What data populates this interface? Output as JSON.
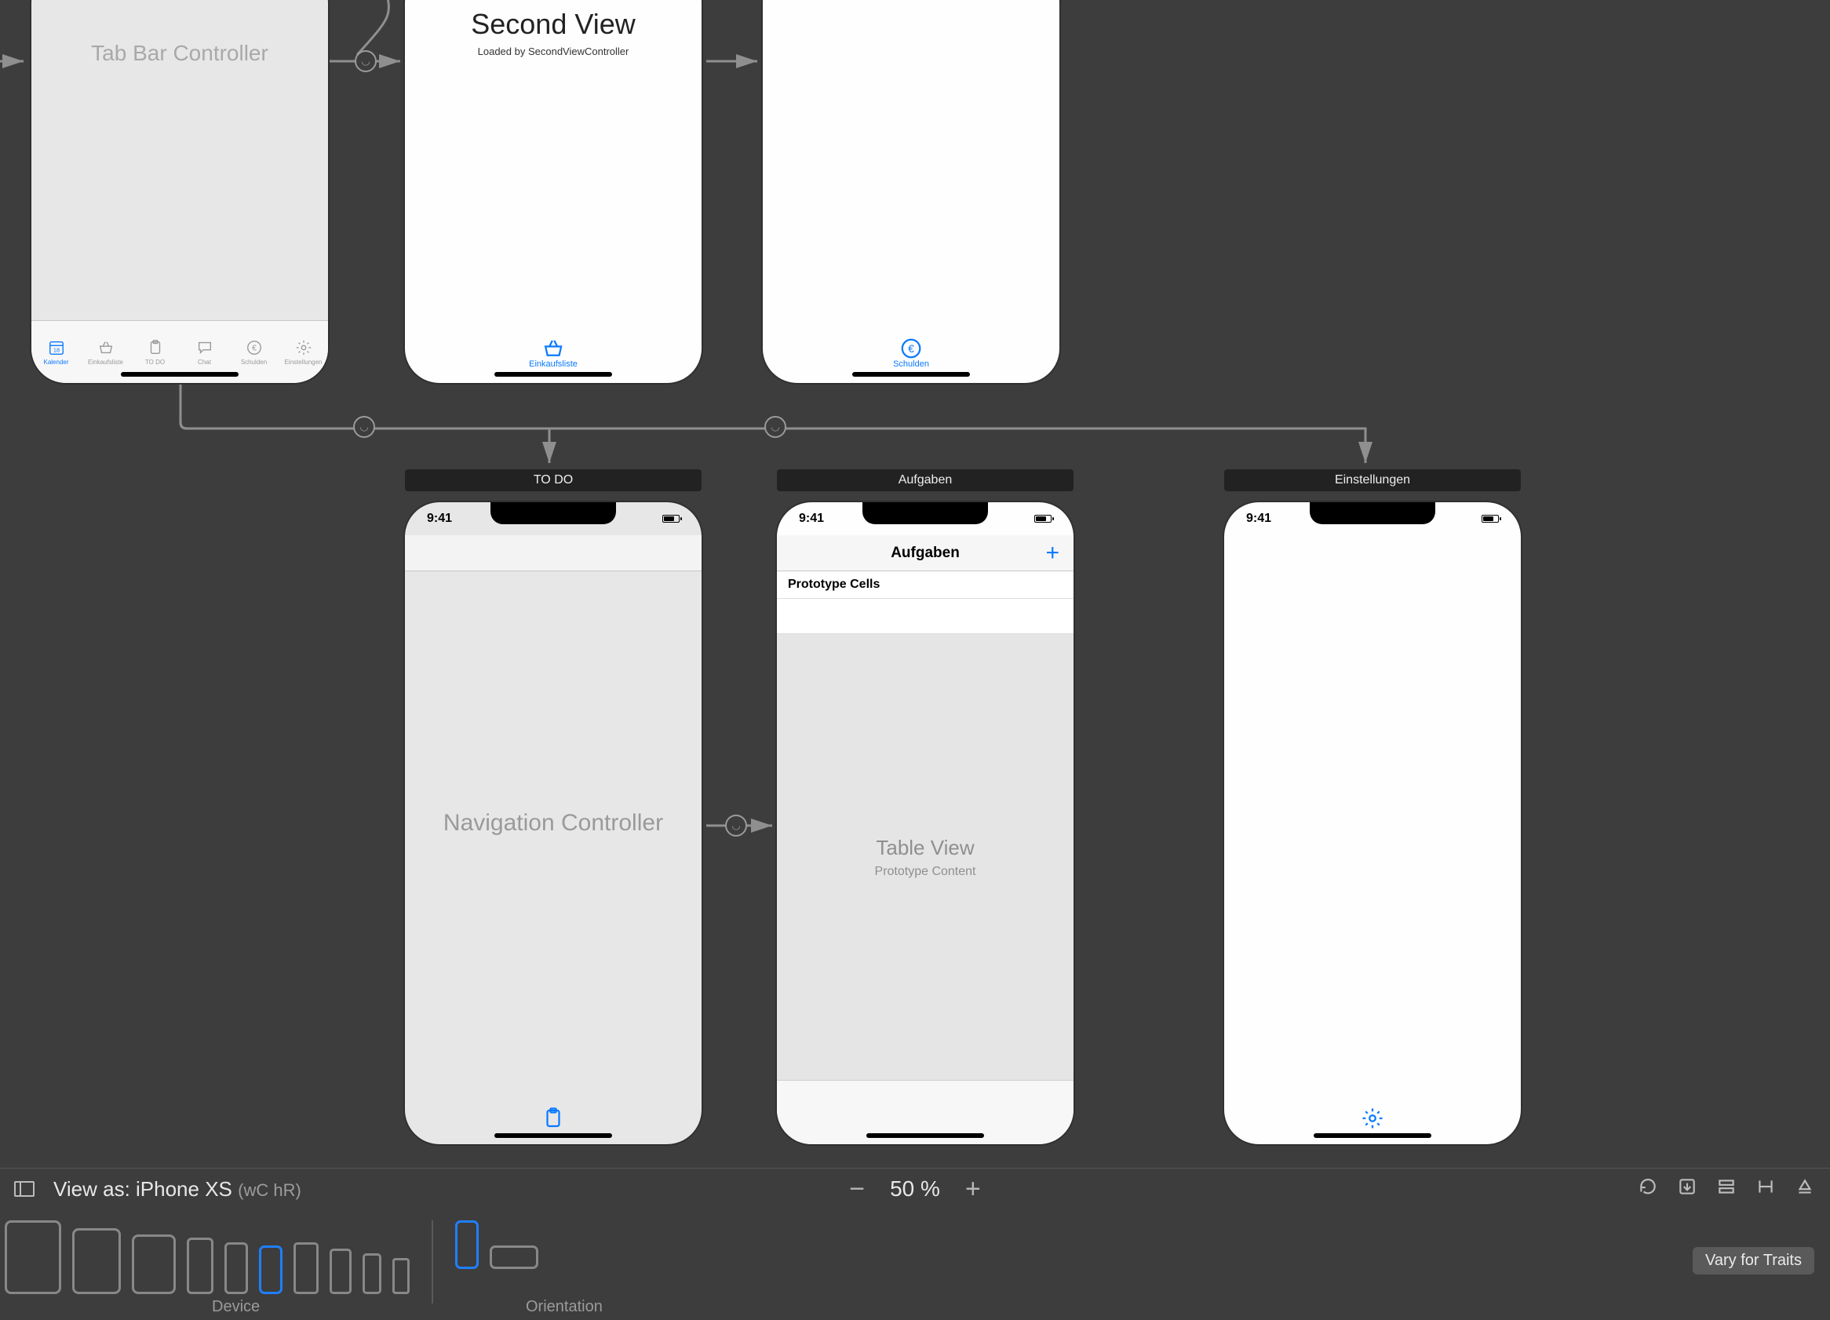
{
  "scenes": {
    "tabBarController": {
      "title": "Tab Bar Controller"
    },
    "secondView": {
      "title": "Second View",
      "subtitle": "Loaded by SecondViewController"
    },
    "navController": {
      "title": "Navigation Controller"
    },
    "tableView": {
      "title": "Table View",
      "subtitle": "Prototype Content",
      "navTitle": "Aufgaben",
      "protoHeader": "Prototype Cells"
    }
  },
  "sceneTitles": {
    "todo": "TO DO",
    "aufgaben": "Aufgaben",
    "einstellungen": "Einstellungen"
  },
  "statusTime": "9:41",
  "tabs": {
    "kalender": "Kalender",
    "einkaufsliste": "Einkaufsliste",
    "todo": "TO DO",
    "chat": "Chat",
    "schulden": "Schulden",
    "einstellungen": "Einstellungen"
  },
  "bottomBar": {
    "viewAs": "View as: iPhone XS",
    "sizeClass": "(wC hR)",
    "zoom": "50 %",
    "deviceLabel": "Device",
    "orientationLabel": "Orientation",
    "varyTraits": "Vary for Traits"
  }
}
